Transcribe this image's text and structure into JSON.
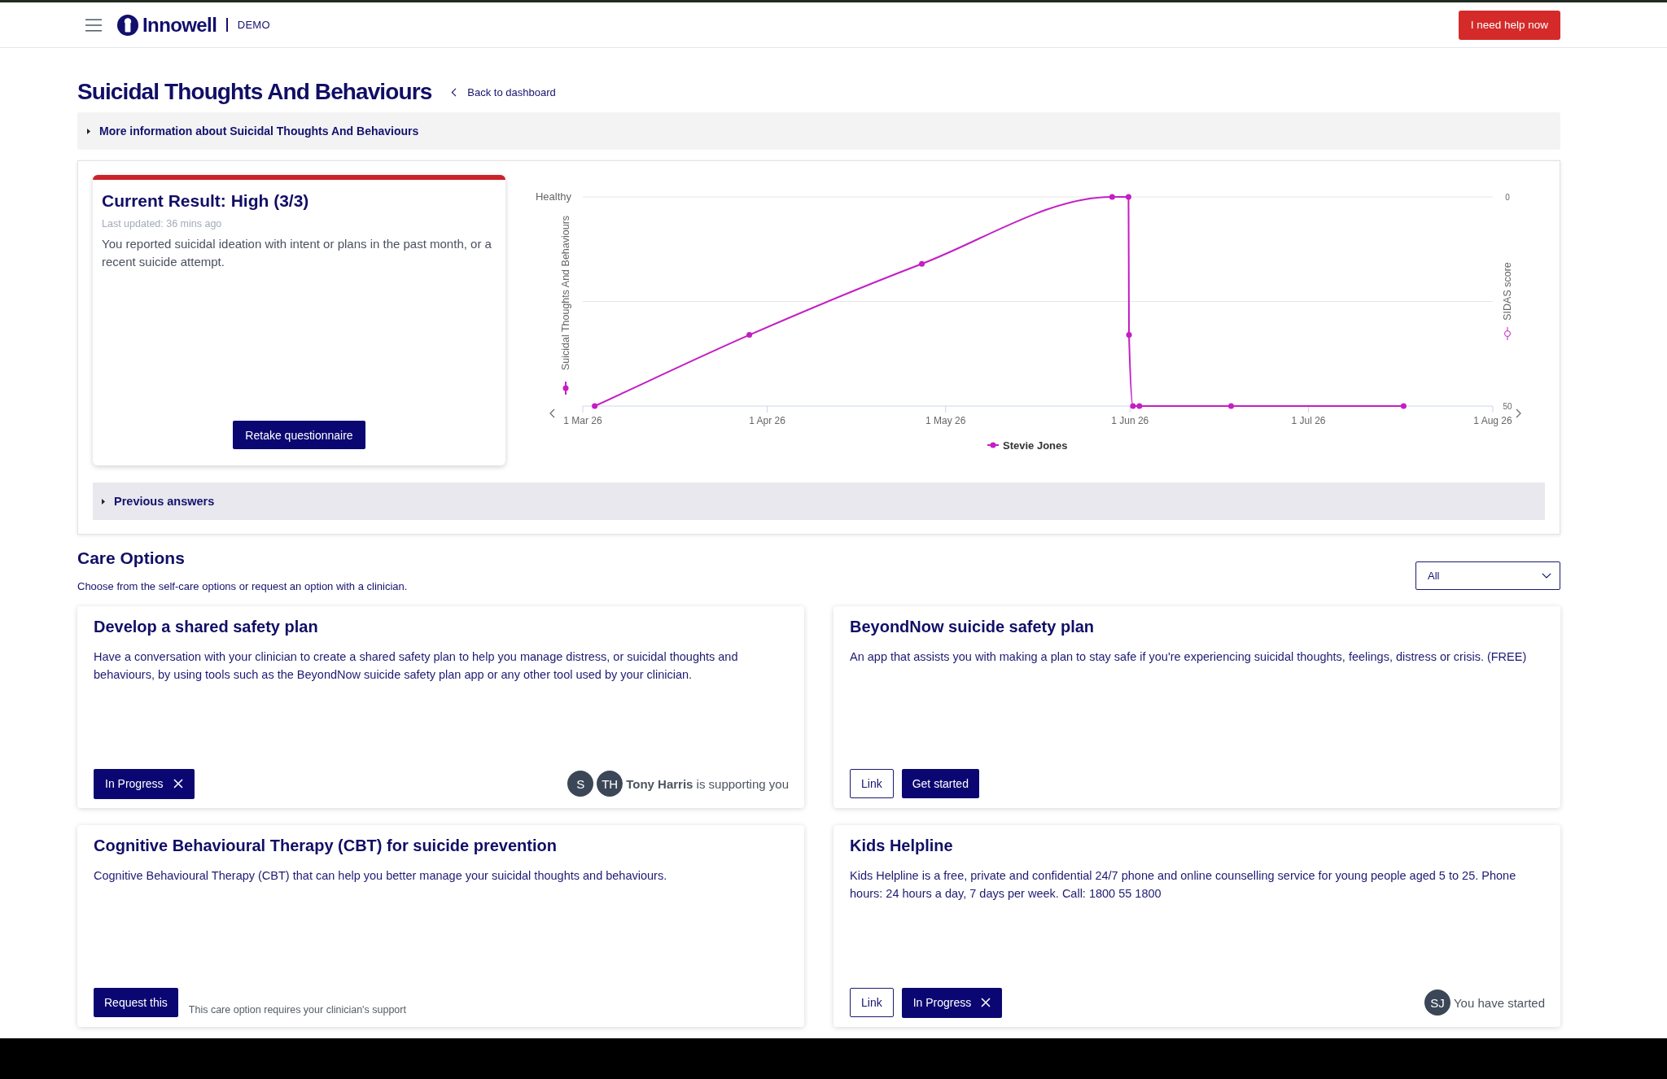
{
  "header": {
    "brand": "Innowell",
    "environment": "DEMO",
    "help_button": "I need help now"
  },
  "page": {
    "title": "Suicidal Thoughts And Behaviours",
    "back_link": "Back to dashboard"
  },
  "more_info": {
    "label": "More information about Suicidal Thoughts And Behaviours",
    "expanded": false
  },
  "current_result": {
    "title": "Current Result: High (3/3)",
    "last_updated": "Last updated: 36 mins ago",
    "description": "You reported suicidal ideation with intent or plans in the past month, or a recent suicide attempt.",
    "button": "Retake questionnaire"
  },
  "chart": {
    "left_axis_title": "Suicidal Thoughts And Behaviours",
    "left_axis_top_label": "Healthy",
    "chart_data": {
      "type": "line",
      "ylabel": "SIDAS score",
      "x": [
        "2026-03-03",
        "2026-03-29",
        "2026-04-27",
        "2026-05-29",
        "2026-05-31T18:00",
        "2026-05-31T20:00",
        "2026-06-01T12:00",
        "2026-06-02T14:00",
        "2026-06-18",
        "2026-07-17"
      ],
      "series": [
        {
          "name": "Stevie Jones",
          "color": "#c41ec4",
          "marker": true,
          "values": [
            50,
            33,
            16,
            0,
            0,
            33,
            50,
            50,
            50,
            50
          ]
        }
      ],
      "xlim": [
        "2026-03-01",
        "2026-08-01"
      ],
      "ylim": [
        50,
        0
      ],
      "xticks": [
        {
          "value": "2026-03-01",
          "label": "1 Mar 26"
        },
        {
          "value": "2026-04-01",
          "label": "1 Apr 26"
        },
        {
          "value": "2026-05-01",
          "label": "1 May 26"
        },
        {
          "value": "2026-06-01",
          "label": "1 Jun 26"
        },
        {
          "value": "2026-07-01",
          "label": "1 Jul 26"
        },
        {
          "value": "2026-08-01",
          "label": "1 Aug 26"
        }
      ],
      "yticks": [
        0,
        50
      ],
      "ref_lines": [
        {
          "axis": "y",
          "value": 25
        }
      ]
    }
  },
  "previous_answers": {
    "label": "Previous answers",
    "expanded": false
  },
  "care_options": {
    "title": "Care Options",
    "subtitle": "Choose from the self-care options or request an option with a clinician.",
    "filter": {
      "value": "All"
    },
    "cards": [
      {
        "title": "Develop a shared safety plan",
        "description": "Have a conversation with your clinician to create a shared safety plan to help you manage distress, or suicidal thoughts and behaviours, by using tools such as the BeyondNow suicide safety plan app or any other tool used by your clinician.",
        "actions": [
          {
            "kind": "status",
            "label": "In Progress"
          }
        ],
        "support": {
          "avatars": [
            "S",
            "TH"
          ],
          "text": "**Tony Harris** is supporting you"
        }
      },
      {
        "title": "BeyondNow suicide safety plan",
        "description": "An app that assists you with making a plan to stay safe if you're experiencing suicidal thoughts, feelings, distress or crisis. (FREE)",
        "actions": [
          {
            "kind": "outline",
            "label": "Link"
          },
          {
            "kind": "primary",
            "label": "Get started"
          }
        ]
      },
      {
        "title": "Cognitive Behavioural Therapy (CBT) for suicide prevention",
        "description": "Cognitive Behavioural Therapy (CBT) that can help you better manage your suicidal thoughts and behaviours.",
        "actions": [
          {
            "kind": "primary",
            "label": "Request this"
          }
        ],
        "note": "This care option requires your clinician's support"
      },
      {
        "title": "Kids Helpline",
        "description": "Kids Helpline is a free, private and confidential 24/7 phone and online counselling service for young people aged 5 to 25. Phone hours: 24 hours a day, 7 days per week. Call: 1800 55 1800",
        "actions": [
          {
            "kind": "outline",
            "label": "Link"
          },
          {
            "kind": "status",
            "label": "In Progress"
          }
        ],
        "support": {
          "avatars": [
            "SJ"
          ],
          "text": "You have started"
        }
      }
    ]
  }
}
